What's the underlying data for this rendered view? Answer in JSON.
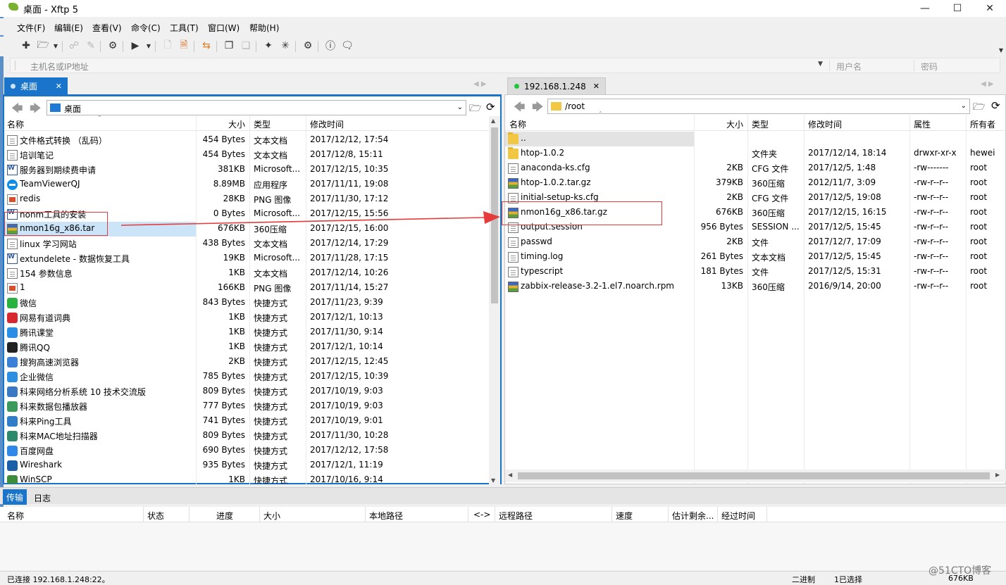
{
  "window": {
    "title": "桌面 - Xftp 5"
  },
  "menu": [
    "文件(F)",
    "编辑(E)",
    "查看(V)",
    "命令(C)",
    "工具(T)",
    "窗口(W)",
    "帮助(H)"
  ],
  "address": {
    "host_placeholder": "主机名或IP地址",
    "user_placeholder": "用户名",
    "pass_placeholder": "密码"
  },
  "left": {
    "tab": "桌面",
    "path": "桌面",
    "columns": [
      "名称",
      "大小",
      "类型",
      "修改时间"
    ],
    "files": [
      {
        "name": "文件格式转换 （乱码）",
        "size": "454 Bytes",
        "type": "文本文档",
        "mtime": "2017/12/12, 17:54",
        "icon": "doc-ic"
      },
      {
        "name": "培训笔记",
        "size": "454 Bytes",
        "type": "文本文档",
        "mtime": "2017/12/8, 15:11",
        "icon": "doc-ic"
      },
      {
        "name": "服务器到期续费申请",
        "size": "381KB",
        "type": "Microsoft...",
        "mtime": "2017/12/15, 10:35",
        "icon": "word-ic"
      },
      {
        "name": "TeamViewerQJ",
        "size": "8.89MB",
        "type": "应用程序",
        "mtime": "2017/11/11, 19:08",
        "icon": "tv-ic"
      },
      {
        "name": "redis",
        "size": "28KB",
        "type": "PNG 图像",
        "mtime": "2017/11/30, 17:12",
        "icon": "png-ic"
      },
      {
        "name": "nonm工具的安装",
        "size": "0 Bytes",
        "type": "Microsoft...",
        "mtime": "2017/12/15, 15:56",
        "icon": "word-ic"
      },
      {
        "name": "nmon16g_x86.tar",
        "size": "676KB",
        "type": "360压缩",
        "mtime": "2017/12/15, 16:00",
        "icon": "archive-ic"
      },
      {
        "name": "linux 学习网站",
        "size": "438 Bytes",
        "type": "文本文档",
        "mtime": "2017/12/14, 17:29",
        "icon": "doc-ic"
      },
      {
        "name": "extundelete - 数据恢复工具",
        "size": "19KB",
        "type": "Microsoft...",
        "mtime": "2017/11/28, 17:15",
        "icon": "word-ic"
      },
      {
        "name": "154 参数信息",
        "size": "1KB",
        "type": "文本文档",
        "mtime": "2017/12/14, 10:26",
        "icon": "doc-ic"
      },
      {
        "name": "1",
        "size": "166KB",
        "type": "PNG 图像",
        "mtime": "2017/11/14, 15:27",
        "icon": "png-ic"
      },
      {
        "name": "微信",
        "size": "843 Bytes",
        "type": "快捷方式",
        "mtime": "2017/11/23, 9:39",
        "icon": "shortcut-ic",
        "color": "#2bb140"
      },
      {
        "name": "网易有道词典",
        "size": "1KB",
        "type": "快捷方式",
        "mtime": "2017/12/1, 10:13",
        "icon": "shortcut-ic",
        "color": "#d7282f"
      },
      {
        "name": "腾讯课堂",
        "size": "1KB",
        "type": "快捷方式",
        "mtime": "2017/11/30, 9:14",
        "icon": "shortcut-ic",
        "color": "#2a8ee6"
      },
      {
        "name": "腾讯QQ",
        "size": "1KB",
        "type": "快捷方式",
        "mtime": "2017/12/1, 10:14",
        "icon": "shortcut-ic",
        "color": "#222222"
      },
      {
        "name": "搜狗高速浏览器",
        "size": "2KB",
        "type": "快捷方式",
        "mtime": "2017/12/15, 12:45",
        "icon": "shortcut-ic",
        "color": "#3b7fd6"
      },
      {
        "name": "企业微信",
        "size": "785 Bytes",
        "type": "快捷方式",
        "mtime": "2017/12/15, 10:39",
        "icon": "shortcut-ic",
        "color": "#2c8fe0"
      },
      {
        "name": "科来网络分析系统 10 技术交流版",
        "size": "809 Bytes",
        "type": "快捷方式",
        "mtime": "2017/10/19, 9:03",
        "icon": "shortcut-ic",
        "color": "#3a78c3"
      },
      {
        "name": "科来数据包播放器",
        "size": "777 Bytes",
        "type": "快捷方式",
        "mtime": "2017/10/19, 9:03",
        "icon": "shortcut-ic",
        "color": "#3a9a5b"
      },
      {
        "name": "科来Ping工具",
        "size": "741 Bytes",
        "type": "快捷方式",
        "mtime": "2017/10/19, 9:01",
        "icon": "shortcut-ic",
        "color": "#2f7dc9"
      },
      {
        "name": "科来MAC地址扫描器",
        "size": "809 Bytes",
        "type": "快捷方式",
        "mtime": "2017/11/30, 10:28",
        "icon": "shortcut-ic",
        "color": "#2c8a6a"
      },
      {
        "name": "百度网盘",
        "size": "690 Bytes",
        "type": "快捷方式",
        "mtime": "2017/12/12, 17:58",
        "icon": "shortcut-ic",
        "color": "#2f88e8"
      },
      {
        "name": "Wireshark",
        "size": "935 Bytes",
        "type": "快捷方式",
        "mtime": "2017/12/1, 11:19",
        "icon": "shortcut-ic",
        "color": "#1b5fa8"
      },
      {
        "name": "WinSCP",
        "size": "1KB",
        "type": "快捷方式",
        "mtime": "2017/10/16, 9:14",
        "icon": "shortcut-ic",
        "color": "#3d8c3a"
      }
    ]
  },
  "right": {
    "tab": "192.168.1.248",
    "path": "/root",
    "columns": [
      "名称",
      "大小",
      "类型",
      "修改时间",
      "属性",
      "所有者"
    ],
    "files": [
      {
        "name": "..",
        "size": "",
        "type": "",
        "mtime": "",
        "attr": "",
        "owner": "",
        "icon": "folder-yl"
      },
      {
        "name": "htop-1.0.2",
        "size": "",
        "type": "文件夹",
        "mtime": "2017/12/14, 18:14",
        "attr": "drwxr-xr-x",
        "owner": "hewei",
        "icon": "folder-yl"
      },
      {
        "name": "anaconda-ks.cfg",
        "size": "2KB",
        "type": "CFG 文件",
        "mtime": "2017/12/5, 1:48",
        "attr": "-rw-------",
        "owner": "root",
        "icon": "doc-ic"
      },
      {
        "name": "htop-1.0.2.tar.gz",
        "size": "379KB",
        "type": "360压缩",
        "mtime": "2012/11/7, 3:09",
        "attr": "-rw-r--r--",
        "owner": "root",
        "icon": "archive-ic"
      },
      {
        "name": "initial-setup-ks.cfg",
        "size": "2KB",
        "type": "CFG 文件",
        "mtime": "2017/12/5, 19:08",
        "attr": "-rw-r--r--",
        "owner": "root",
        "icon": "doc-ic"
      },
      {
        "name": "nmon16g_x86.tar.gz",
        "size": "676KB",
        "type": "360压缩",
        "mtime": "2017/12/15, 16:15",
        "attr": "-rw-r--r--",
        "owner": "root",
        "icon": "archive-ic"
      },
      {
        "name": "output.session",
        "size": "956 Bytes",
        "type": "SESSION ...",
        "mtime": "2017/12/5, 15:45",
        "attr": "-rw-r--r--",
        "owner": "root",
        "icon": "doc-ic"
      },
      {
        "name": "passwd",
        "size": "2KB",
        "type": "文件",
        "mtime": "2017/12/7, 17:09",
        "attr": "-rw-r--r--",
        "owner": "root",
        "icon": "doc-ic"
      },
      {
        "name": "timing.log",
        "size": "261 Bytes",
        "type": "文本文档",
        "mtime": "2017/12/5, 15:45",
        "attr": "-rw-r--r--",
        "owner": "root",
        "icon": "doc-ic"
      },
      {
        "name": "typescript",
        "size": "181 Bytes",
        "type": "文件",
        "mtime": "2017/12/5, 15:31",
        "attr": "-rw-r--r--",
        "owner": "root",
        "icon": "doc-ic"
      },
      {
        "name": "zabbix-release-3.2-1.el7.noarch.rpm",
        "size": "13KB",
        "type": "360压缩",
        "mtime": "2016/9/14, 20:00",
        "attr": "-rw-r--r--",
        "owner": "root",
        "icon": "archive-ic"
      }
    ]
  },
  "log": {
    "tabs": [
      "传输",
      "日志"
    ],
    "columns": [
      "名称",
      "状态",
      "进度",
      "大小",
      "本地路径",
      "<->",
      "远程路径",
      "速度",
      "估计剩余...",
      "经过时间"
    ]
  },
  "status": {
    "connection": "已连接 192.168.1.248:22。",
    "mode": "二进制",
    "selected": "1已选择",
    "size": "676KB",
    "watermark": "@51CTO博客"
  }
}
